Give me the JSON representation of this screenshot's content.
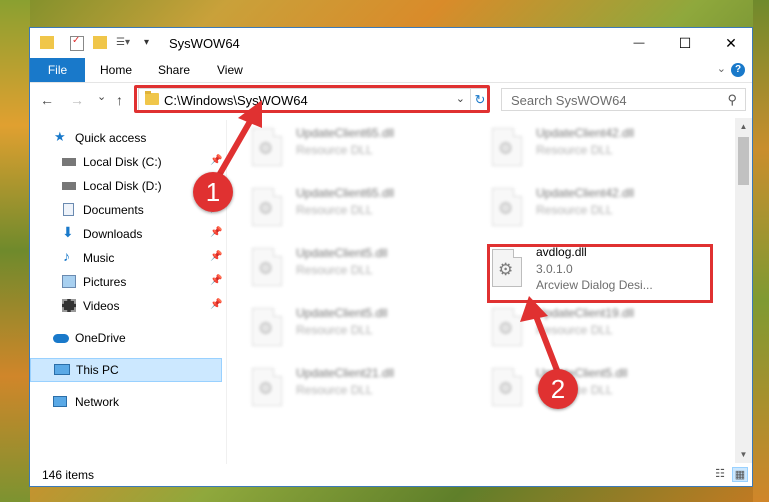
{
  "window": {
    "title": "SysWOW64",
    "controls": {
      "minimize": "—",
      "maximize": "☐",
      "close": "✕"
    }
  },
  "ribbon": {
    "file_label": "File",
    "tabs": [
      {
        "label": "Home"
      },
      {
        "label": "Share"
      },
      {
        "label": "View"
      }
    ],
    "help_label": "?"
  },
  "navigation": {
    "back": "←",
    "forward": "→",
    "recent": "⌄",
    "up": "↑",
    "address": "C:\\Windows\\SysWOW64",
    "search_placeholder": "Search SysWOW64"
  },
  "sidebar": {
    "items": [
      {
        "label": "Quick access"
      },
      {
        "label": "Local Disk (C:)"
      },
      {
        "label": "Local Disk (D:)"
      },
      {
        "label": "Documents"
      },
      {
        "label": "Downloads"
      },
      {
        "label": "Music"
      },
      {
        "label": "Pictures"
      },
      {
        "label": "Videos"
      },
      {
        "label": "OneDrive"
      },
      {
        "label": "This PC"
      },
      {
        "label": "Network"
      }
    ]
  },
  "files": {
    "left": [
      {
        "name": "UpdateClient65.dll",
        "type": "Resource DLL"
      },
      {
        "name": "UpdateClient65.dll",
        "type": "Resource DLL"
      },
      {
        "name": "UpdateClient5.dll",
        "type": "Resource DLL"
      },
      {
        "name": "UpdateClient5.dll",
        "type": "Resource DLL"
      },
      {
        "name": "UpdateClient21.dll",
        "type": "Resource DLL"
      }
    ],
    "right": [
      {
        "name": "UpdateClient42.dll",
        "type": "Resource DLL"
      },
      {
        "name": "UpdateClient42.dll",
        "type": "Resource DLL"
      },
      {
        "name": "UpdateClient19.dll",
        "type": "Resource DLL"
      },
      {
        "name": "UpdateClient5.dll",
        "type": "Resource DLL"
      }
    ],
    "highlighted": {
      "name": "avdlog.dll",
      "version": "3.0.1.0",
      "description": "Arcview Dialog Desi..."
    }
  },
  "status": {
    "item_count": "146 items"
  },
  "annotations": {
    "step1": "1",
    "step2": "2",
    "color": "#e03131"
  }
}
